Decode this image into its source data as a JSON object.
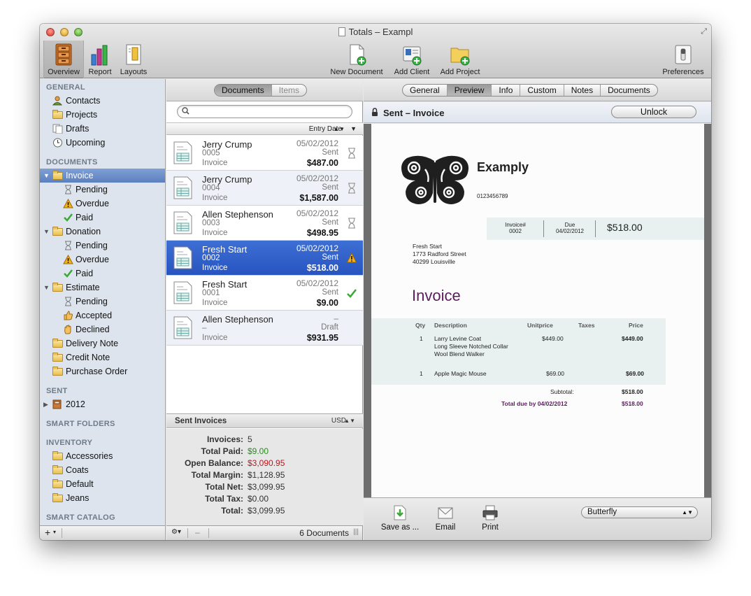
{
  "window": {
    "title": "Totals – Exampl",
    "toolbar": {
      "overview": "Overview",
      "report": "Report",
      "layouts": "Layouts",
      "new_document": "New Document",
      "add_client": "Add Client",
      "add_project": "Add Project",
      "preferences": "Preferences"
    }
  },
  "sidebar": {
    "general_header": "GENERAL",
    "general": [
      "Contacts",
      "Projects",
      "Drafts",
      "Upcoming"
    ],
    "documents_header": "DOCUMENTS",
    "invoice": "Invoice",
    "invoice_children": [
      "Pending",
      "Overdue",
      "Paid"
    ],
    "donation": "Donation",
    "donation_children": [
      "Pending",
      "Overdue",
      "Paid"
    ],
    "estimate": "Estimate",
    "estimate_children": [
      "Pending",
      "Accepted",
      "Declined"
    ],
    "other_docs": [
      "Delivery Note",
      "Credit Note",
      "Purchase Order"
    ],
    "sent_header": "SENT",
    "sent_year": "2012",
    "smart_folders_header": "SMART FOLDERS",
    "inventory_header": "INVENTORY",
    "inventory": [
      "Accessories",
      "Coats",
      "Default",
      "Jeans"
    ],
    "smart_catalog_header": "SMART CATALOG",
    "add_button": "+",
    "add_menu_arrow": "▾"
  },
  "list": {
    "tabs": [
      "Documents",
      "Items"
    ],
    "search_placeholder": "",
    "sort_label": "Entry Date",
    "sort_arrows": "▲▼",
    "sort_menu": "▼",
    "rows": [
      {
        "name": "Jerry Crump",
        "number": "0005",
        "type": "Invoice",
        "date": "05/02/2012",
        "status": "Sent",
        "amount": "$487.00",
        "status_icon": "hourglass-icon"
      },
      {
        "name": "Jerry Crump",
        "number": "0004",
        "type": "Invoice",
        "date": "05/02/2012",
        "status": "Sent",
        "amount": "$1,587.00",
        "status_icon": "hourglass-icon"
      },
      {
        "name": "Allen Stephenson",
        "number": "0003",
        "type": "Invoice",
        "date": "05/02/2012",
        "status": "Sent",
        "amount": "$498.95",
        "status_icon": "hourglass-icon"
      },
      {
        "name": "Fresh Start",
        "number": "0002",
        "type": "Invoice",
        "date": "05/02/2012",
        "status": "Sent",
        "amount": "$518.00",
        "status_icon": "warning-icon"
      },
      {
        "name": "Fresh Start",
        "number": "0001",
        "type": "Invoice",
        "date": "05/02/2012",
        "status": "Sent",
        "amount": "$9.00",
        "status_icon": "checkmark-icon"
      },
      {
        "name": "Allen Stephenson",
        "number": "–",
        "type": "Invoice",
        "date": "–",
        "status": "Draft",
        "amount": "$931.95",
        "status_icon": ""
      }
    ],
    "summary_title": "Sent Invoices",
    "currency": "USD",
    "currency_arrows": "▲▼",
    "summary": [
      {
        "label": "Invoices:",
        "value": "5",
        "color": "#333333"
      },
      {
        "label": "Total Paid:",
        "value": "$9.00",
        "color": "#2a8a1f"
      },
      {
        "label": "Open Balance:",
        "value": "$3,090.95",
        "color": "#c0151b"
      },
      {
        "label": "Total Margin:",
        "value": "$1,128.95",
        "color": "#333333"
      },
      {
        "label": "Total Net:",
        "value": "$3,099.95",
        "color": "#333333"
      },
      {
        "label": "Total Tax:",
        "value": "$0.00",
        "color": "#333333"
      },
      {
        "label": "Total:",
        "value": "$3,099.95",
        "color": "#333333"
      }
    ],
    "doc_count": "6 Documents",
    "gear_menu": "⚙▾",
    "remove": "–"
  },
  "detail": {
    "tabs": [
      "General",
      "Preview",
      "Info",
      "Custom",
      "Notes",
      "Documents"
    ],
    "active_tab": "Preview",
    "lock_label": "Sent – Invoice",
    "unlock": "Unlock",
    "invoice": {
      "company": "Examply",
      "company_number": "0123456789",
      "invoice_no_label": "Invoice#",
      "invoice_no": "0002",
      "due_label": "Due",
      "due": "04/02/2012",
      "total": "$518.00",
      "client_lines": [
        "Fresh Start",
        "1773 Radford Street",
        "40299 Louisville"
      ],
      "heading": "Invoice",
      "columns": [
        "Qty",
        "Description",
        "Unitprice",
        "Taxes",
        "Price"
      ],
      "items": [
        {
          "qty": "1",
          "desc": [
            "Larry Levine Coat",
            "Long Sleeve Notched Collar",
            "Wool Blend Walker"
          ],
          "unit": "$449.00",
          "taxes": "",
          "price": "$449.00"
        },
        {
          "qty": "1",
          "desc": [
            "Apple Magic Mouse"
          ],
          "unit": "$69.00",
          "taxes": "",
          "price": "$69.00"
        }
      ],
      "subtotal_label": "Subtotal:",
      "subtotal": "$518.00",
      "total_due_label": "Total due by 04/02/2012",
      "total_due": "$518.00",
      "accent_color": "#5a1e5c"
    },
    "bottom": {
      "save_as": "Save as ...",
      "email": "Email",
      "print": "Print",
      "layout_popup": "Butterfly",
      "layout_arrows": "▲▼"
    }
  }
}
